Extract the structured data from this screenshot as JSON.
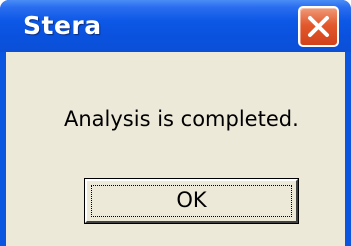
{
  "window": {
    "title": "Stera",
    "close_icon": "close-icon",
    "colors": {
      "titlebar": "#0a52de",
      "close_button": "#e2592d",
      "client_background": "#ece9d8"
    }
  },
  "dialog": {
    "message": "Analysis is completed.",
    "ok_label": "OK"
  }
}
